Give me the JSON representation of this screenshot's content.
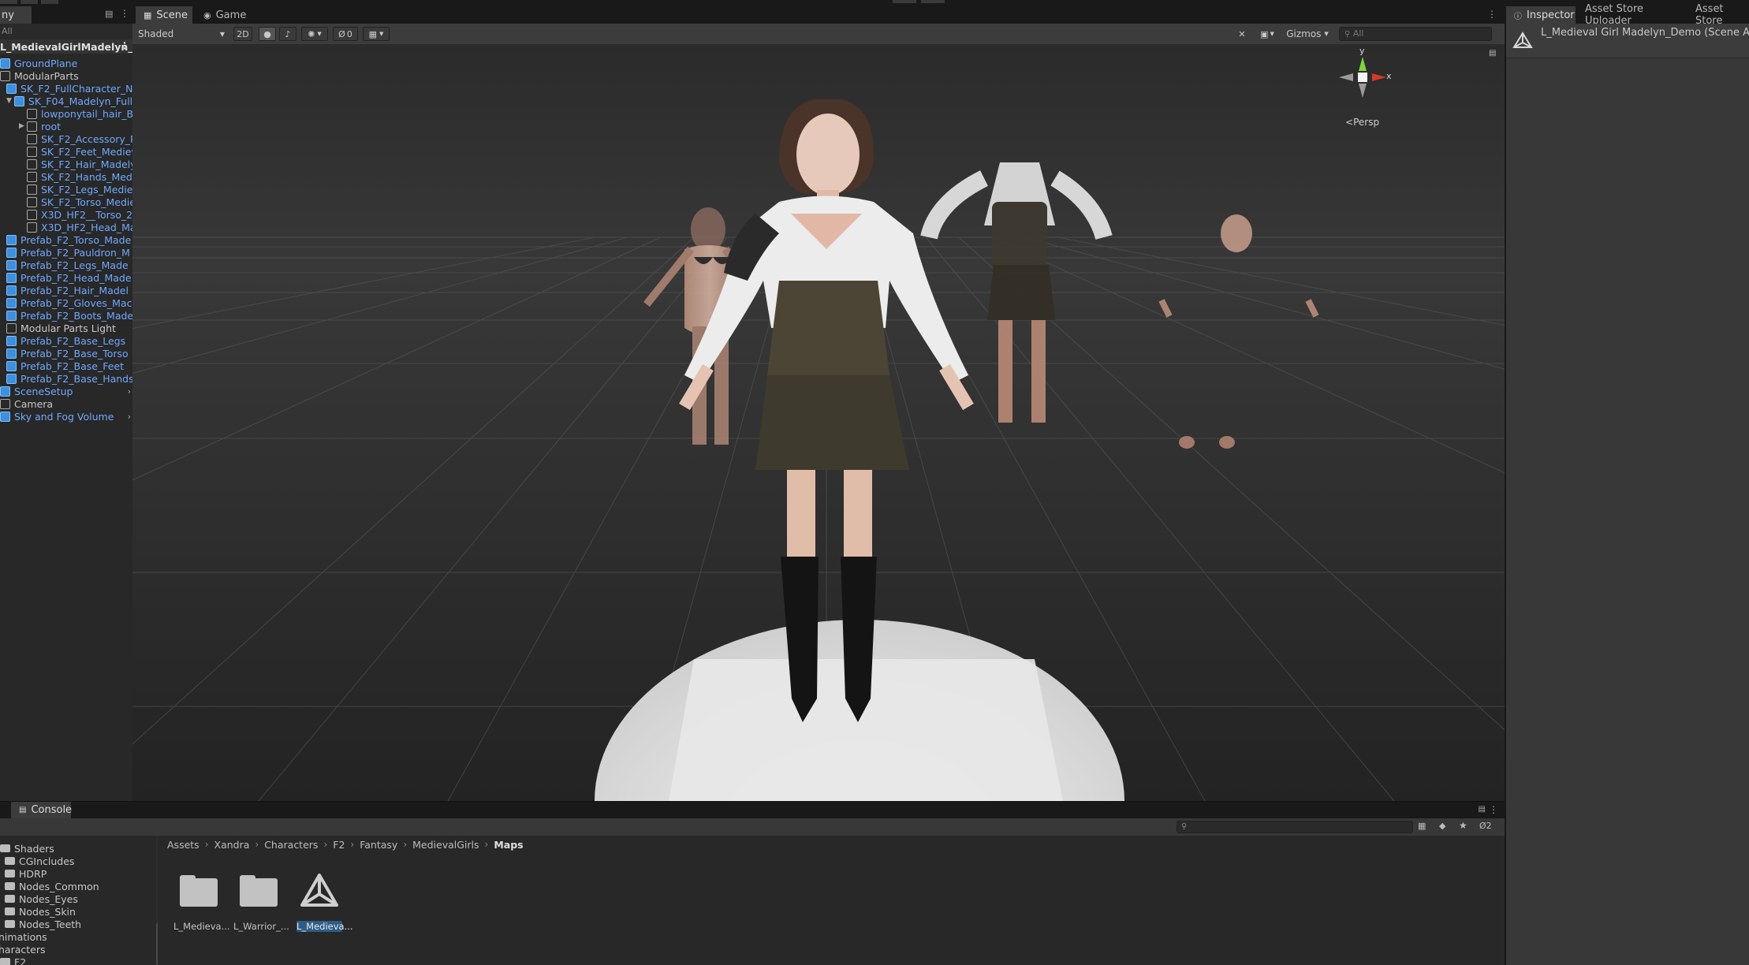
{
  "hierarchy": {
    "tab_label": "ny",
    "search_value": "All",
    "scene_name": "L_MedievalGirlMadelyn_D",
    "items": [
      {
        "label": "GroundPlane",
        "blue": true,
        "indent": 0
      },
      {
        "label": "ModularParts",
        "blue": false,
        "indent": 0
      },
      {
        "label": "SK_F2_FullCharacter_N",
        "blue": true,
        "indent": 1
      },
      {
        "label": "SK_F04_Madelyn_FullB",
        "blue": true,
        "indent": 1
      },
      {
        "label": "lowponytail_hair_B.0",
        "blue": true,
        "indent": 2
      },
      {
        "label": "root",
        "blue": true,
        "indent": 2
      },
      {
        "label": "SK_F2_Accessory_Pa",
        "blue": true,
        "indent": 2
      },
      {
        "label": "SK_F2_Feet_Medieva",
        "blue": true,
        "indent": 2
      },
      {
        "label": "SK_F2_Hair_Madelyn",
        "blue": true,
        "indent": 2
      },
      {
        "label": "SK_F2_Hands_Medie",
        "blue": true,
        "indent": 2
      },
      {
        "label": "SK_F2_Legs_Mediev",
        "blue": true,
        "indent": 2
      },
      {
        "label": "SK_F2_Torso_Medie",
        "blue": true,
        "indent": 2
      },
      {
        "label": "X3D_HF2__Torso_2_",
        "blue": true,
        "indent": 2
      },
      {
        "label": "X3D_HF2_Head_Mac",
        "blue": true,
        "indent": 2
      },
      {
        "label": "Prefab_F2_Torso_Made",
        "blue": true,
        "indent": 1
      },
      {
        "label": "Prefab_F2_Pauldron_M",
        "blue": true,
        "indent": 1
      },
      {
        "label": "Prefab_F2_Legs_Made",
        "blue": true,
        "indent": 1
      },
      {
        "label": "Prefab_F2_Head_Made",
        "blue": true,
        "indent": 1
      },
      {
        "label": "Prefab_F2_Hair_Madel",
        "blue": true,
        "indent": 1
      },
      {
        "label": "Prefab_F2_Gloves_Mac",
        "blue": true,
        "indent": 1
      },
      {
        "label": "Prefab_F2_Boots_Made",
        "blue": true,
        "indent": 1
      },
      {
        "label": "Modular Parts Light",
        "blue": false,
        "indent": 1
      },
      {
        "label": "Prefab_F2_Base_Legs",
        "blue": true,
        "indent": 1
      },
      {
        "label": "Prefab_F2_Base_Torso",
        "blue": true,
        "indent": 1
      },
      {
        "label": "Prefab_F2_Base_Feet",
        "blue": true,
        "indent": 1
      },
      {
        "label": "Prefab_F2_Base_Hands",
        "blue": true,
        "indent": 1
      },
      {
        "label": "SceneSetup",
        "blue": true,
        "indent": 0
      },
      {
        "label": "Camera",
        "blue": false,
        "indent": 0
      },
      {
        "label": "Sky and Fog Volume",
        "blue": true,
        "indent": 0
      }
    ]
  },
  "scene": {
    "tabs": [
      "Scene",
      "Game"
    ],
    "draw_mode": "Shaded",
    "btn_2d": "2D",
    "hidden_count": "0",
    "gizmos_label": "Gizmos",
    "search_placeholder": "All",
    "gizmo_y": "y",
    "gizmo_x": "x",
    "persp_label": "Persp"
  },
  "inspector": {
    "tabs": [
      "Inspector",
      "Asset Store Uploader",
      "Asset Store"
    ],
    "title": "L_Medieval Girl Madelyn_Demo (Scene Ass"
  },
  "console": {
    "tab_label": "Console"
  },
  "project": {
    "tree": [
      {
        "label": "Shaders",
        "indent": 0
      },
      {
        "label": "CGIncludes",
        "indent": 1
      },
      {
        "label": "HDRP",
        "indent": 1
      },
      {
        "label": "Nodes_Common",
        "indent": 1
      },
      {
        "label": "Nodes_Eyes",
        "indent": 1
      },
      {
        "label": "Nodes_Skin",
        "indent": 1
      },
      {
        "label": "Nodes_Teeth",
        "indent": 1
      },
      {
        "label": "nimations",
        "indent": -1
      },
      {
        "label": "haracters",
        "indent": -1
      },
      {
        "label": "F2",
        "indent": 0
      }
    ],
    "breadcrumb": [
      "Assets",
      "Xandra",
      "Characters",
      "F2",
      "Fantasy",
      "MedievalGirls",
      "Maps"
    ],
    "assets": [
      {
        "label": "L_Medieva...",
        "kind": "folder"
      },
      {
        "label": "L_Warrior_...",
        "kind": "folder"
      },
      {
        "label": "L_Medieva...",
        "kind": "unity-scene"
      }
    ],
    "hidden_count": "2"
  },
  "colors": {
    "accent_blue": "#2c5d87",
    "prefab_blue": "#6fa8ff",
    "viewport_bg": "#2a2a2a"
  }
}
